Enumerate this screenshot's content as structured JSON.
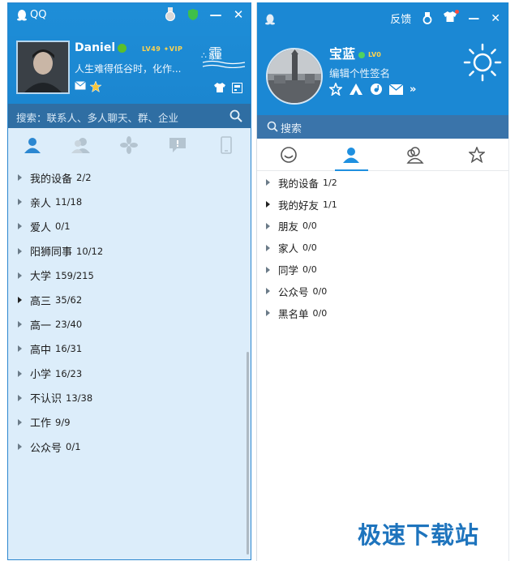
{
  "left_window": {
    "app_title": "QQ",
    "titlebar": {
      "minimize": "—",
      "close": "✕"
    },
    "profile": {
      "name": "Daniel",
      "level_badge": "LV49 ✦VIP",
      "signature": "人生难得低谷时，化作...",
      "weather_text": "霾"
    },
    "search": {
      "placeholder": "搜索：联系人、多人聊天、群、企业"
    },
    "tabs": [
      {
        "icon": "contacts-icon",
        "active": true
      },
      {
        "icon": "groups-icon",
        "active": false
      },
      {
        "icon": "apps-icon",
        "active": false
      },
      {
        "icon": "chat-icon",
        "active": false
      },
      {
        "icon": "phone-icon",
        "active": false
      }
    ],
    "groups": [
      {
        "name": "我的设备",
        "count": "2/2",
        "expanded": false
      },
      {
        "name": "亲人",
        "count": "11/18",
        "expanded": false
      },
      {
        "name": "爱人",
        "count": "0/1",
        "expanded": false
      },
      {
        "name": "阳狮同事",
        "count": "10/12",
        "expanded": false
      },
      {
        "name": "大学",
        "count": "159/215",
        "expanded": false
      },
      {
        "name": "高三",
        "count": "35/62",
        "expanded": true
      },
      {
        "name": "高一",
        "count": "23/40",
        "expanded": false
      },
      {
        "name": "高中",
        "count": "16/31",
        "expanded": false
      },
      {
        "name": "小学",
        "count": "16/23",
        "expanded": false
      },
      {
        "name": "不认识",
        "count": "13/38",
        "expanded": false
      },
      {
        "name": "工作",
        "count": "9/9",
        "expanded": false
      },
      {
        "name": "公众号",
        "count": "0/1",
        "expanded": false
      }
    ]
  },
  "right_window": {
    "titlebar": {
      "feedback": "反馈",
      "minimize": "—",
      "close": "✕"
    },
    "profile": {
      "name": "宝蓝",
      "level_badge": "LV0",
      "signature": "编辑个性签名"
    },
    "search": {
      "placeholder": "搜索"
    },
    "groups": [
      {
        "name": "我的设备",
        "count": "1/2",
        "expanded": false
      },
      {
        "name": "我的好友",
        "count": "1/1",
        "expanded": true
      },
      {
        "name": "朋友",
        "count": "0/0",
        "expanded": false
      },
      {
        "name": "家人",
        "count": "0/0",
        "expanded": false
      },
      {
        "name": "同学",
        "count": "0/0",
        "expanded": false
      },
      {
        "name": "公众号",
        "count": "0/0",
        "expanded": false
      },
      {
        "name": "黑名单",
        "count": "0/0",
        "expanded": false
      }
    ]
  },
  "watermark": "极速下载站",
  "colors": {
    "brand_blue": "#1b88d4",
    "list_bg_left": "#dcedfa",
    "search_bar": "#2f6ea3"
  }
}
